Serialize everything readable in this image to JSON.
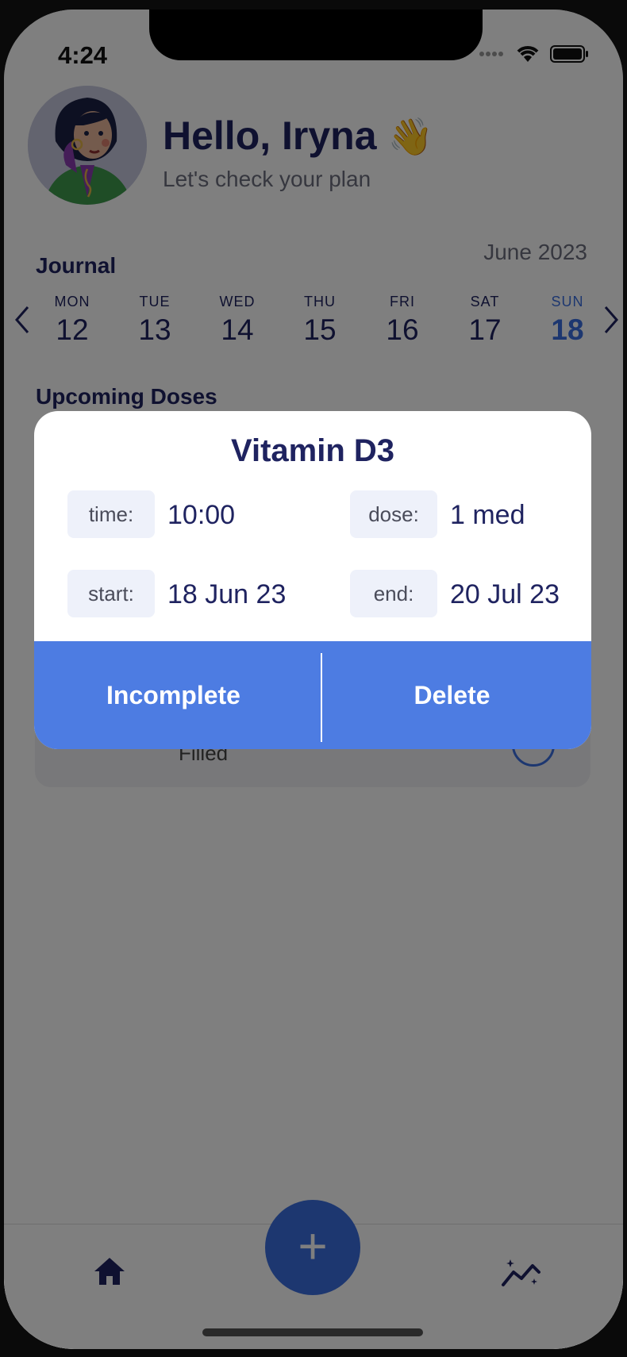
{
  "status": {
    "time": "4:24"
  },
  "header": {
    "greeting": "Hello, Iryna",
    "wave": "👋",
    "subtitle": "Let's check your plan"
  },
  "journal": {
    "label": "Journal",
    "month": "June 2023",
    "days": [
      {
        "name": "MON",
        "date": "12"
      },
      {
        "name": "TUE",
        "date": "13"
      },
      {
        "name": "WED",
        "date": "14"
      },
      {
        "name": "THU",
        "date": "15"
      },
      {
        "name": "FRI",
        "date": "16"
      },
      {
        "name": "SAT",
        "date": "17"
      },
      {
        "name": "SUN",
        "date": "18"
      }
    ],
    "selected_day": "18"
  },
  "upcoming": {
    "label": "Upcoming Doses",
    "card_status": "Filled"
  },
  "modal": {
    "title": "Vitamin D3",
    "time_label": "time:",
    "time_value": "10:00",
    "dose_label": "dose:",
    "dose_value": "1 med",
    "start_label": "start:",
    "start_value": "18 Jun 23",
    "end_label": "end:",
    "end_value": "20 Jul 23",
    "incomplete_label": "Incomplete",
    "delete_label": "Delete"
  },
  "tabbar": {
    "home_icon": "home-icon",
    "add_glyph": "+",
    "stats_icon": "stats-icon"
  },
  "colors": {
    "accent": "#4d7ce2",
    "title": "#1f2360",
    "chip": "#eef1fa"
  }
}
